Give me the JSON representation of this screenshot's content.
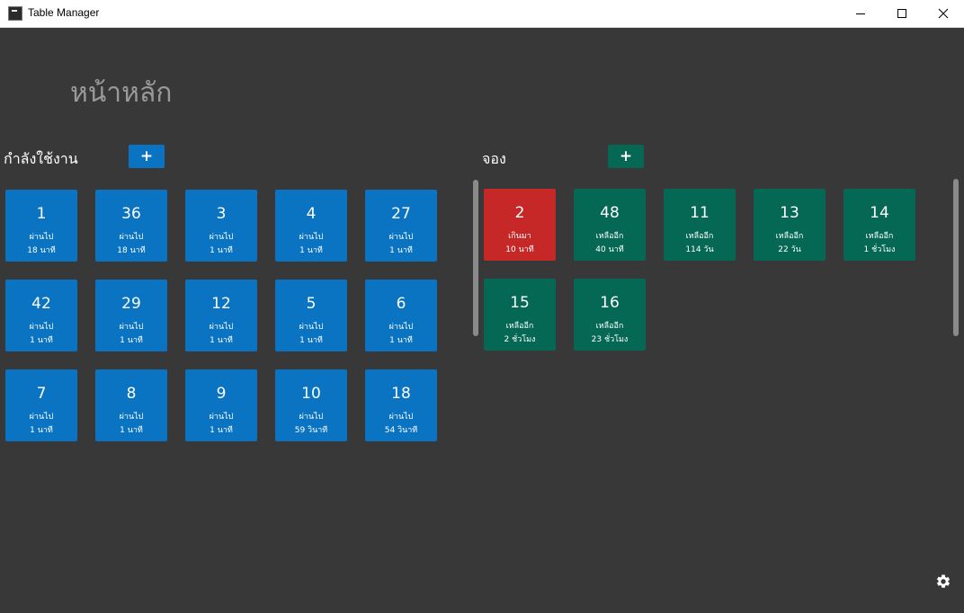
{
  "window": {
    "title": "Table Manager"
  },
  "page": {
    "title": "หน้าหลัก"
  },
  "active": {
    "title": "กำลังใช้งาน",
    "add_label": "+",
    "tiles": [
      {
        "number": "1",
        "label": "ผ่านไป",
        "duration": "18 นาที"
      },
      {
        "number": "36",
        "label": "ผ่านไป",
        "duration": "18 นาที"
      },
      {
        "number": "3",
        "label": "ผ่านไป",
        "duration": "1 นาที"
      },
      {
        "number": "4",
        "label": "ผ่านไป",
        "duration": "1 นาที"
      },
      {
        "number": "27",
        "label": "ผ่านไป",
        "duration": "1 นาที"
      },
      {
        "number": "42",
        "label": "ผ่านไป",
        "duration": "1 นาที"
      },
      {
        "number": "29",
        "label": "ผ่านไป",
        "duration": "1 นาที"
      },
      {
        "number": "12",
        "label": "ผ่านไป",
        "duration": "1 นาที"
      },
      {
        "number": "5",
        "label": "ผ่านไป",
        "duration": "1 นาที"
      },
      {
        "number": "6",
        "label": "ผ่านไป",
        "duration": "1 นาที"
      },
      {
        "number": "7",
        "label": "ผ่านไป",
        "duration": "1 นาที"
      },
      {
        "number": "8",
        "label": "ผ่านไป",
        "duration": "1 นาที"
      },
      {
        "number": "9",
        "label": "ผ่านไป",
        "duration": "1 นาที"
      },
      {
        "number": "10",
        "label": "ผ่านไป",
        "duration": "59 วินาที"
      },
      {
        "number": "18",
        "label": "ผ่านไป",
        "duration": "54 วินาที"
      }
    ]
  },
  "reserved": {
    "title": "จอง",
    "add_label": "+",
    "tiles": [
      {
        "number": "2",
        "label": "เกินมา",
        "duration": "10 นาที",
        "status": "overdue"
      },
      {
        "number": "48",
        "label": "เหลืออีก",
        "duration": "40 นาที",
        "status": "upcoming"
      },
      {
        "number": "11",
        "label": "เหลืออีก",
        "duration": "114 วัน",
        "status": "upcoming"
      },
      {
        "number": "13",
        "label": "เหลืออีก",
        "duration": "22 วัน",
        "status": "upcoming"
      },
      {
        "number": "14",
        "label": "เหลืออีก",
        "duration": "1 ชั่วโมง",
        "status": "upcoming"
      },
      {
        "number": "15",
        "label": "เหลืออีก",
        "duration": "2 ชั่วโมง",
        "status": "upcoming"
      },
      {
        "number": "16",
        "label": "เหลืออีก",
        "duration": "23 ชั่วโมง",
        "status": "upcoming"
      }
    ]
  },
  "colors": {
    "background": "#383838",
    "active_tile": "#0a74c2",
    "reserved_tile": "#046854",
    "overdue_tile": "#c62828"
  },
  "icons": {
    "settings": "gear-icon",
    "minimize": "minimize-icon",
    "maximize": "maximize-icon",
    "close": "close-icon",
    "app": "app-icon"
  }
}
